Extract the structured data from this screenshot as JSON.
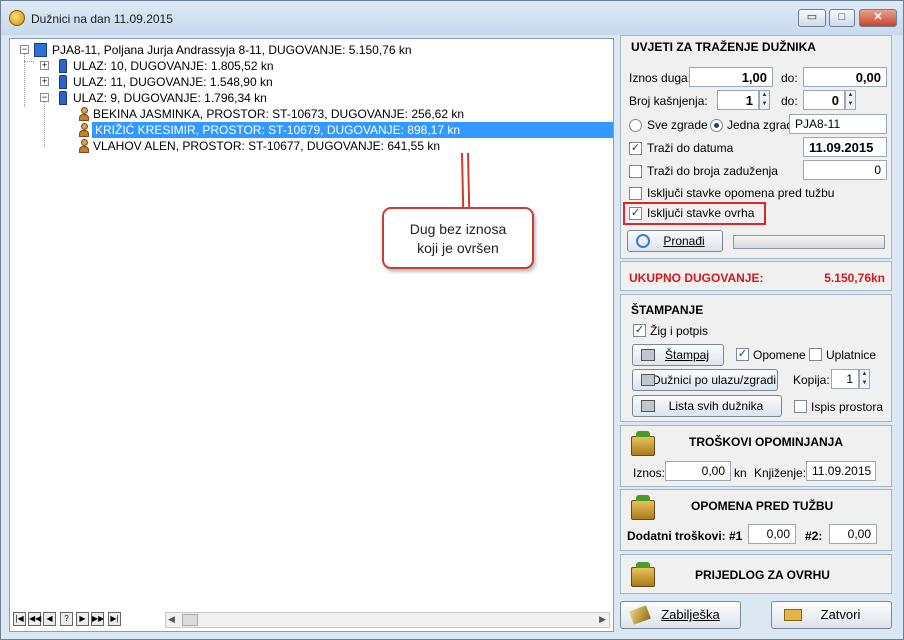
{
  "window": {
    "title": "Dužnici na dan 11.09.2015",
    "minimize": "▭",
    "maximize": "□",
    "close": "✕"
  },
  "tree": {
    "root": "PJA8-11,  Poljana Jurja Andrassyja 8-11,   DUGOVANJE: 5.150,76 kn",
    "ulaz10": "ULAZ: 10,   DUGOVANJE: 1.805,52 kn",
    "ulaz11": "ULAZ: 11,   DUGOVANJE: 1.548,90 kn",
    "ulaz9": "ULAZ: 9,   DUGOVANJE: 1.796,34 kn",
    "debtor1": "BEKINA JASMINKA,   PROSTOR: ST-10673,   DUGOVANJE: 256,62 kn",
    "debtor2": "KRIŽIĆ KRESIMIR,   PROSTOR: ST-10679,   DUGOVANJE: 898,17 kn",
    "debtor3": "VLAHOV ALEN,   PROSTOR: ST-10677,   DUGOVANJE: 641,55 kn",
    "expand_plus": "+",
    "expand_minus": "−"
  },
  "callout": {
    "text_line1": "Dug bez iznosa",
    "text_line2": "koji je ovršen",
    "border_color": "#cc3c32"
  },
  "nav": {
    "first": "|◀",
    "prev_page": "◀◀",
    "prev": "◀",
    "help": "?",
    "next": "▶",
    "next_page": "▶▶",
    "last": "▶|"
  },
  "search": {
    "title": "UVJETI ZA TRAŽENJE DUŽNIKA",
    "iznos_label": "Iznos duga:",
    "iznos_from": "1,00",
    "do_label": "do:",
    "iznos_to": "0,00",
    "kasnjenja_label": "Broj kašnjenja:",
    "kasnjenja_from": "1",
    "kasnjenja_to": "0",
    "sve_zgrade": "Sve zgrade",
    "jedna_zgrada": "Jedna zgrada:",
    "zgrada_value": "PJA8-11",
    "trazi_datum": "Traži do datuma",
    "datum_value": "11.09.2015",
    "trazi_zaduzenja": "Traži do broja zaduženja",
    "zaduzenja_value": "0",
    "iskljuci_opomena": "Isključi stavke opomena pred tužbu",
    "iskljuci_ovrha": "Isključi stavke ovrha",
    "pronadi": "Pronađi",
    "highlight_color": "#e0262b"
  },
  "total": {
    "label": "UKUPNO DUGOVANJE:",
    "value": "5.150,76kn",
    "color": "#d11a1a"
  },
  "print": {
    "title": "ŠTAMPANJE",
    "zig": "Žig i potpis",
    "stampaj": "Štampaj",
    "opomene": "Opomene",
    "uplatnice": "Uplatnice",
    "duznici_ulaz": "Dužnici po ulazu/zgradi",
    "kopija_label": "Kopija:",
    "kopija_value": "1",
    "lista": "Lista svih dužnika",
    "ispis_prostora": "Ispis prostora"
  },
  "costs": {
    "title": "TROŠKOVI OPOMINJANJA",
    "iznos_label": "Iznos:",
    "iznos_value": "0,00",
    "kn": "kn",
    "knjizenje_label": "Knjiženje:",
    "knjizenje_value": "11.09.2015"
  },
  "warning": {
    "title": "OPOMENA PRED TUŽBU",
    "dodatni_label": "Dodatni troškovi:",
    "n1_label": "#1",
    "n1_value": "0,00",
    "n2_label": "#2:",
    "n2_value": "0,00"
  },
  "proposal": {
    "title": "PRIJEDLOG ZA OVRHU"
  },
  "footer": {
    "zabiljeska": "Zabilješka",
    "zatvori": "Zatvori"
  },
  "icons": {
    "check": "✓"
  }
}
